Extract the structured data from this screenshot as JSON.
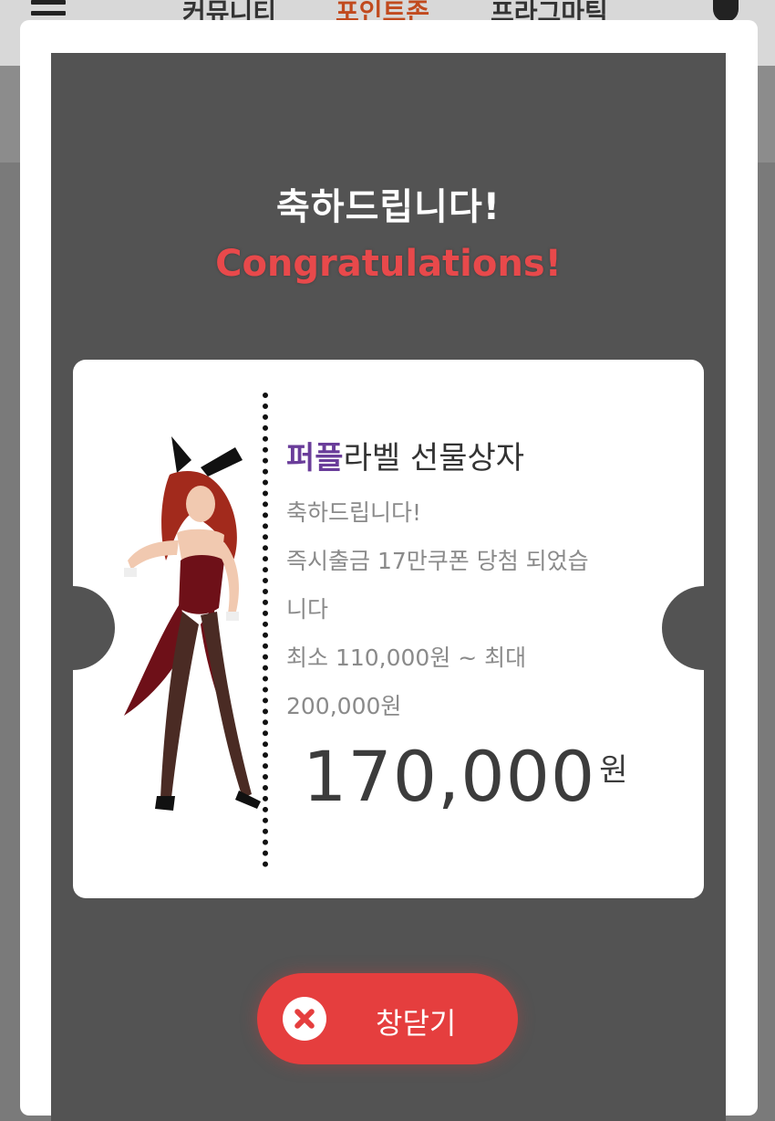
{
  "background_nav": {
    "items": [
      "커뮤니티",
      "포인트존",
      "프라그마틱"
    ],
    "active_index": 1
  },
  "modal": {
    "title_ko": "축하드립니다!",
    "title_en": "Congratulations!",
    "ticket": {
      "title_brand": "퍼플",
      "title_rest": "라벨 선물상자",
      "message_lines": [
        "축하드립니다!",
        "즉시출금 17만쿠폰 당첨 되었습",
        "니다",
        "최소 110,000원 ~ 최대",
        "200,000원"
      ],
      "amount": "170,000",
      "unit": "원"
    },
    "close_button": {
      "label": "창닫기",
      "icon": "close-icon"
    }
  },
  "colors": {
    "panel": "#535353",
    "accent_red": "#e53e3e",
    "brand_purple": "#6a3d9a"
  }
}
